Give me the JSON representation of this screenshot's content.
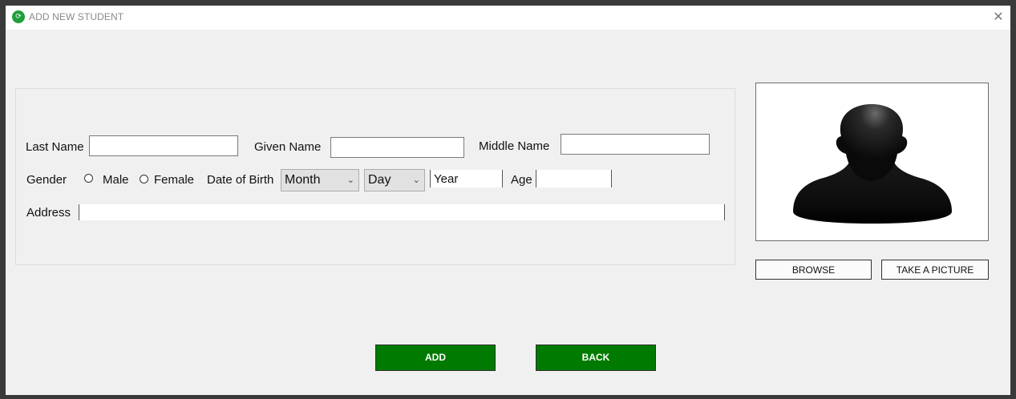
{
  "window": {
    "title": "ADD NEW STUDENT",
    "close_glyph": "✕",
    "icon_glyph": "⟳"
  },
  "form": {
    "last_name_label": "Last Name",
    "last_name_value": "",
    "given_name_label": "Given Name",
    "given_name_value": "",
    "middle_name_label": "Middle Name",
    "middle_name_value": "",
    "gender_label": "Gender",
    "gender_options": [
      "Male",
      "Female"
    ],
    "dob_label": "Date of Birth",
    "month_value": "Month",
    "day_value": "Day",
    "year_value": "Year",
    "age_label": "Age",
    "age_value": "",
    "address_label": "Address",
    "address_value": ""
  },
  "photo_buttons": {
    "browse": "BROWSE",
    "take_picture": "TAKE A PICTURE"
  },
  "actions": {
    "add": "ADD",
    "back": "BACK"
  },
  "colors": {
    "primary_button": "#007a00",
    "window_bg": "#f0f0f0"
  },
  "icons": {
    "app": "app-icon",
    "close": "close-icon",
    "photo_placeholder": "person-silhouette-icon",
    "dropdown": "chevron-down-icon"
  }
}
